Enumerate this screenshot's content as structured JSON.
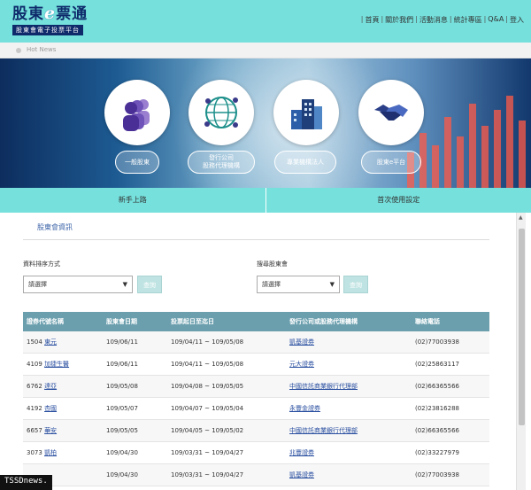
{
  "logo": {
    "title_left": "股東",
    "title_e": "e",
    "title_right": "票通",
    "subtitle": "股東會電子投票平台"
  },
  "topnav": [
    "首頁",
    "關於我們",
    "活動消息",
    "統計專區",
    "Q&A",
    "登入"
  ],
  "hotnews": {
    "label": "Hot News"
  },
  "banner": {
    "buttons": [
      "一般股東",
      "發行公司\n股務代理機構",
      "專業機構法人",
      "股東e平台"
    ]
  },
  "tabs": [
    "新手上路",
    "首次使用設定"
  ],
  "section": {
    "title": "股東會資訊"
  },
  "filters": {
    "sort_label": "資料排序方式",
    "sort_value": "請選擇",
    "search_label": "搜尋股東會",
    "search_value": "請選擇",
    "query_label": "查詢"
  },
  "table": {
    "headers": [
      "證券代號名稱",
      "股東會日期",
      "投票起日至迄日",
      "發行公司或股務代理機構",
      "聯絡電話"
    ],
    "rows": [
      {
        "code": "1504",
        "name": "東元",
        "date": "109/06/11",
        "period": "109/04/11 ~ 109/05/08",
        "agent": "凱基證券",
        "phone": "(02)77003938"
      },
      {
        "code": "4109",
        "name": "加捷生醫",
        "date": "109/06/11",
        "period": "109/04/11 ~ 109/05/08",
        "agent": "元大證券",
        "phone": "(02)25863117"
      },
      {
        "code": "6762",
        "name": "達亞",
        "date": "109/05/08",
        "period": "109/04/08 ~ 109/05/05",
        "agent": "中國信託商業銀行代理部",
        "phone": "(02)66365566"
      },
      {
        "code": "4192",
        "name": "杏國",
        "date": "109/05/07",
        "period": "109/04/07 ~ 109/05/04",
        "agent": "永豐金證券",
        "phone": "(02)23816288"
      },
      {
        "code": "6657",
        "name": "華安",
        "date": "109/05/05",
        "period": "109/04/05 ~ 109/05/02",
        "agent": "中國信託商業銀行代理部",
        "phone": "(02)66365566"
      },
      {
        "code": "3073",
        "name": "凱柏",
        "date": "109/04/30",
        "period": "109/03/31 ~ 109/04/27",
        "agent": "兆豐證券",
        "phone": "(02)33227979"
      },
      {
        "code": "",
        "name": "",
        "date": "109/04/30",
        "period": "109/03/31 ~ 109/04/27",
        "agent": "凱基證券",
        "phone": "(02)77003938"
      }
    ]
  },
  "watermark": "TSSDnews."
}
